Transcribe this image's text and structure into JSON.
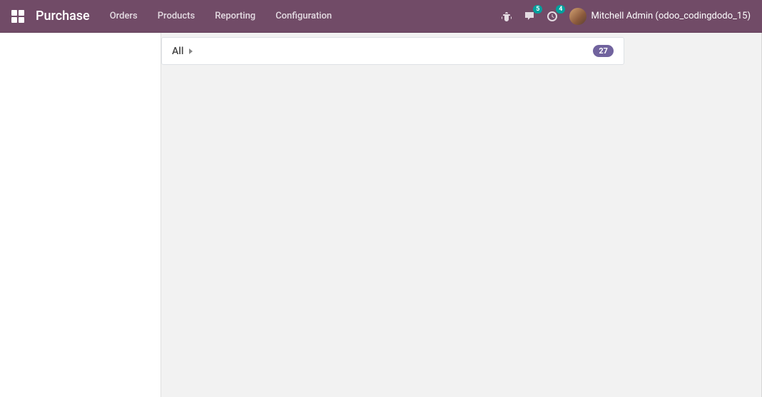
{
  "navbar": {
    "app_title": "Purchase",
    "menu": [
      {
        "label": "Orders"
      },
      {
        "label": "Products"
      },
      {
        "label": "Reporting"
      },
      {
        "label": "Configuration"
      }
    ],
    "messages_badge": "5",
    "activities_badge": "4",
    "user_display": "Mitchell Admin (odoo_codingdodo_15)"
  },
  "content": {
    "group": {
      "label": "All",
      "count": "27"
    }
  }
}
